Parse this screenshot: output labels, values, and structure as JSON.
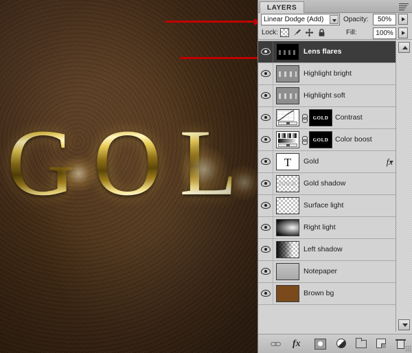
{
  "canvas": {
    "text": "GOL",
    "background_color": "#4c2d16",
    "gold_color": "#e8cb55"
  },
  "panel": {
    "tab_label": "LAYERS",
    "menu_icon": "panel-menu-icon",
    "options": {
      "blend_mode": "Linear Dodge (Add)",
      "opacity_label": "Opacity:",
      "opacity_value": "50%",
      "fill_label": "Fill:",
      "fill_value": "100%",
      "lock_label": "Lock:"
    },
    "layers": [
      {
        "name": "Lens flares",
        "selected": true,
        "visible": true,
        "thumb": "dark",
        "mask": null,
        "fx": false
      },
      {
        "name": "Highlight bright",
        "selected": false,
        "visible": true,
        "thumb": "gray",
        "mask": null,
        "fx": false
      },
      {
        "name": "Highlight soft",
        "selected": false,
        "visible": true,
        "thumb": "gray-soft",
        "mask": null,
        "fx": false
      },
      {
        "name": "Contrast",
        "selected": false,
        "visible": true,
        "thumb": "curve",
        "mask": "GOLD",
        "fx": false
      },
      {
        "name": "Color boost",
        "selected": false,
        "visible": true,
        "thumb": "levels",
        "mask": "GOLD",
        "fx": false
      },
      {
        "name": "Gold",
        "selected": false,
        "visible": true,
        "thumb": "type",
        "mask": null,
        "fx": true,
        "fx_label": "fx"
      },
      {
        "name": "Gold shadow",
        "selected": false,
        "visible": true,
        "thumb": "goldshadow",
        "mask": null,
        "fx": false,
        "thumb_text": "GOLD"
      },
      {
        "name": "Surface light",
        "selected": false,
        "visible": true,
        "thumb": "transparent",
        "mask": null,
        "fx": false
      },
      {
        "name": "Right light",
        "selected": false,
        "visible": true,
        "thumb": "rightlight",
        "mask": null,
        "fx": false
      },
      {
        "name": "Left shadow",
        "selected": false,
        "visible": true,
        "thumb": "leftshadow",
        "mask": null,
        "fx": false
      },
      {
        "name": "Notepaper",
        "selected": false,
        "visible": true,
        "thumb": "notepaper",
        "mask": null,
        "fx": false
      },
      {
        "name": "Brown bg",
        "selected": false,
        "visible": true,
        "thumb": "brown",
        "mask": null,
        "fx": false
      }
    ],
    "footer_buttons": [
      "link-layers-icon",
      "layer-style-fx-icon",
      "add-mask-icon",
      "new-adjustment-layer-icon",
      "new-group-icon",
      "new-layer-icon",
      "delete-layer-icon"
    ]
  },
  "annotations": {
    "arrow_blend_mode": "points to blend mode dropdown",
    "arrow_eye": "points to Lens flares visibility eye",
    "arrow_opacity": "points up to Opacity value",
    "arrow_color": "#c00000"
  }
}
